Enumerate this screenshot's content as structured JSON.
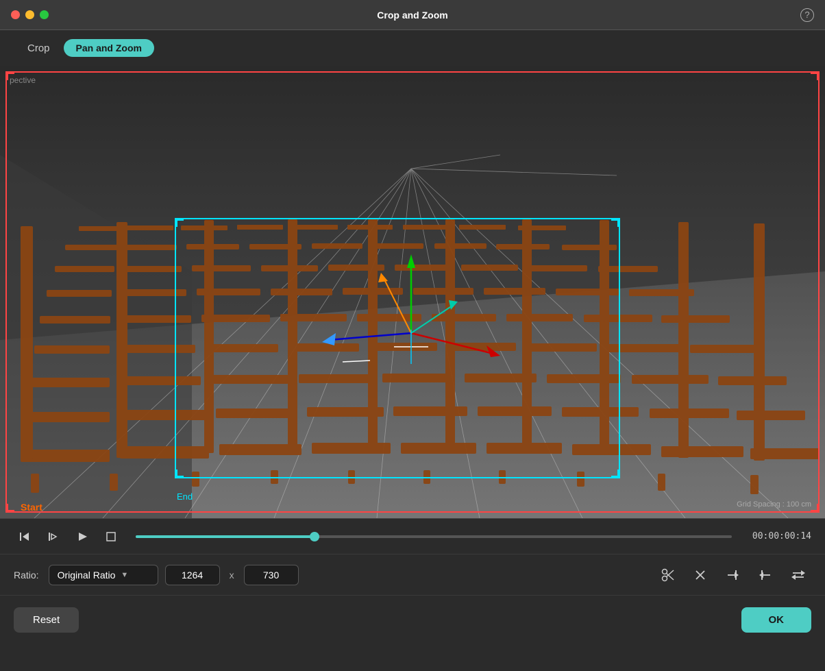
{
  "window": {
    "title": "Crop and Zoom"
  },
  "tabs": {
    "crop": "Crop",
    "panzoom": "Pan and Zoom"
  },
  "viewport": {
    "label_perspective": "pective",
    "label_start": "Start",
    "label_end": "End",
    "label_grid": "Grid Spacing : 100 cm"
  },
  "controls": {
    "timecode": "00:00:00:14"
  },
  "ratio": {
    "label": "Ratio:",
    "selected": "Original Ratio",
    "width": "1264",
    "height": "730"
  },
  "footer": {
    "reset_label": "Reset",
    "ok_label": "OK"
  },
  "icons": {
    "help": "?",
    "step_back": "⇤",
    "play_frame": "⊳",
    "play": "▶",
    "stop": "□",
    "cut": "✂",
    "close": "✕",
    "arrow_in": "→|",
    "arrow_out": "|←",
    "flip": "⇐"
  }
}
